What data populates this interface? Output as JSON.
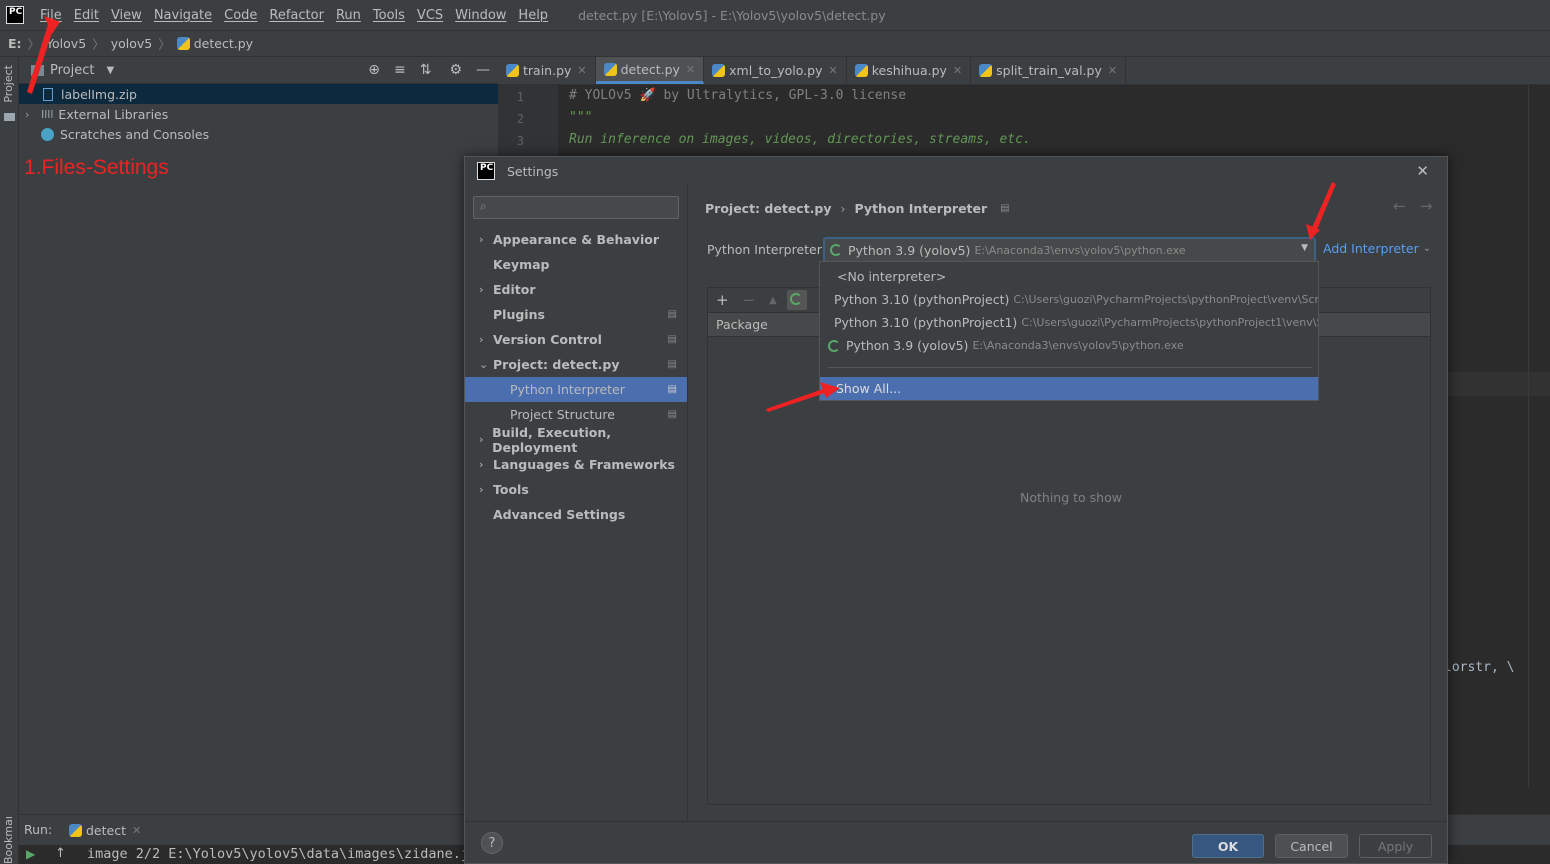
{
  "menubar": {
    "items": [
      "File",
      "Edit",
      "View",
      "Navigate",
      "Code",
      "Refactor",
      "Run",
      "Tools",
      "VCS",
      "Window",
      "Help"
    ],
    "window_title": "detect.py [E:\\Yolov5] - E:\\Yolov5\\yolov5\\detect.py"
  },
  "breadcrumb": [
    "E:",
    "Yolov5",
    "yolov5",
    "detect.py"
  ],
  "left_stripe": {
    "project": "Project",
    "bookmarks": "Bookmarks"
  },
  "project_panel": {
    "title": "Project",
    "items": [
      {
        "label": "labelImg.zip",
        "selected": true
      },
      {
        "label": "External Libraries"
      },
      {
        "label": "Scratches and Consoles"
      }
    ]
  },
  "annotation": {
    "text": "1.Files-Settings",
    "color": "#ee2222"
  },
  "editor": {
    "tabs": [
      {
        "label": "train.py"
      },
      {
        "label": "detect.py",
        "active": true
      },
      {
        "label": "xml_to_yolo.py"
      },
      {
        "label": "keshihua.py"
      },
      {
        "label": "split_train_val.py"
      }
    ],
    "lines": [
      {
        "no": "1",
        "text": "# YOLOv5 🚀 by Ultralytics, GPL-3.0 license"
      },
      {
        "no": "2",
        "text": "\"\"\""
      },
      {
        "no": "3",
        "text": "Run inference on images, videos, directories, streams, etc."
      }
    ],
    "partial_text": "lorstr, \\"
  },
  "run_panel": {
    "label": "Run:",
    "tab": "detect",
    "output": "image 2/2 E:\\Yolov5\\yolov5\\data\\images\\zidane.j"
  },
  "settings": {
    "title": "Settings",
    "search_placeholder": "",
    "sidebar": [
      {
        "label": "Appearance & Behavior",
        "chevron": "right"
      },
      {
        "label": "Keymap"
      },
      {
        "label": "Editor",
        "chevron": "right"
      },
      {
        "label": "Plugins",
        "pin": true
      },
      {
        "label": "Version Control",
        "chevron": "right",
        "pin": true
      },
      {
        "label": "Project: detect.py",
        "chevron": "down",
        "pin": true
      },
      {
        "label": "Python Interpreter",
        "sub": true,
        "selected": true,
        "pin": true
      },
      {
        "label": "Project Structure",
        "sub": true,
        "pin": true
      },
      {
        "label": "Build, Execution, Deployment",
        "chevron": "right"
      },
      {
        "label": "Languages & Frameworks",
        "chevron": "right"
      },
      {
        "label": "Tools",
        "chevron": "right"
      },
      {
        "label": "Advanced Settings"
      }
    ],
    "breadcrumb": {
      "parent": "Project: detect.py",
      "current": "Python Interpreter"
    },
    "interpreter_label": "Python Interpreter:",
    "interpreter_value": "Python 3.9 (yolov5)",
    "interpreter_path": "E:\\Anaconda3\\envs\\yolov5\\python.exe",
    "add_interpreter": "Add Interpreter",
    "package_header": "Package",
    "empty_text": "Nothing to show",
    "buttons": {
      "ok": "OK",
      "cancel": "Cancel",
      "apply": "Apply",
      "help": "?"
    }
  },
  "popup": {
    "items": [
      {
        "label": "<No interpreter>",
        "path": ""
      },
      {
        "label": "Python 3.10 (pythonProject)",
        "path": "C:\\Users\\guozi\\PycharmProjects\\pythonProject\\venv\\Scr"
      },
      {
        "label": "Python 3.10 (pythonProject1)",
        "path": "C:\\Users\\guozi\\PycharmProjects\\pythonProject1\\venv\\S"
      },
      {
        "label": "Python 3.9 (yolov5)",
        "path": "E:\\Anaconda3\\envs\\yolov5\\python.exe"
      }
    ],
    "show_all": "Show All..."
  },
  "colors": {
    "accent": "#4b6eaf",
    "link": "#589df6",
    "annotation": "#ee2222",
    "comment": "#808080",
    "docstring": "#629755"
  }
}
